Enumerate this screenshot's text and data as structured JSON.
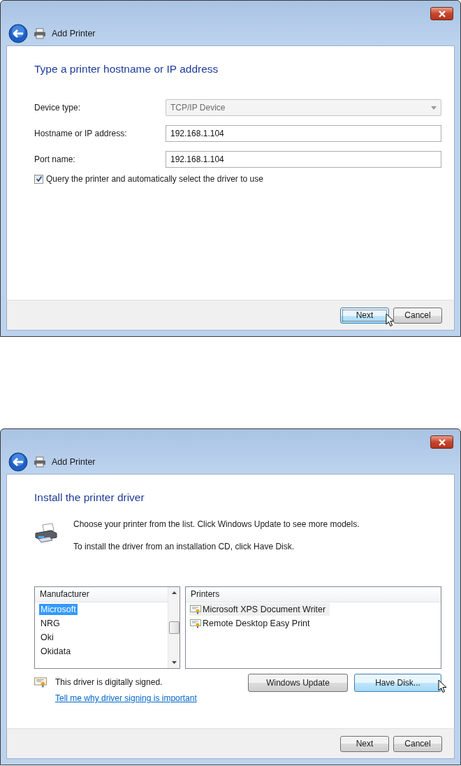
{
  "dialogs": [
    {
      "kind": "address",
      "title": "Add Printer",
      "heading": "Type a printer hostname or IP address",
      "fields": [
        {
          "kind": "dropdown",
          "label": "Device type:",
          "value": "TCP/IP Device",
          "disabled": true
        },
        {
          "kind": "text",
          "label": "Hostname or IP address:",
          "value": "192.168.1.104",
          "disabled": false
        },
        {
          "kind": "text",
          "label": "Port name:",
          "value": "192.168.1.104",
          "disabled": false
        }
      ],
      "checkbox": {
        "label": "Query the printer and automatically select the driver to use",
        "checked": true
      },
      "buttons": [
        {
          "label": "Next",
          "default": true,
          "hovered": true
        },
        {
          "label": "Cancel",
          "default": false,
          "hovered": false
        }
      ]
    },
    {
      "kind": "driver",
      "title": "Add Printer",
      "heading": "Install the printer driver",
      "intro": [
        "Choose your printer from the list. Click Windows Update to see more models.",
        "To install the driver from an installation CD, click Have Disk."
      ],
      "manufacturers": {
        "header": "Manufacturer",
        "items": [
          {
            "label": "Microsoft",
            "selected": true
          },
          {
            "label": "NRG",
            "selected": false
          },
          {
            "label": "Oki",
            "selected": false
          },
          {
            "label": "Okidata",
            "selected": false
          }
        ]
      },
      "printers": {
        "header": "Printers",
        "items": [
          {
            "label": "Microsoft XPS Document Writer",
            "selected": true
          },
          {
            "label": "Remote Desktop Easy Print",
            "selected": false
          }
        ]
      },
      "signed": "This driver is digitally signed.",
      "link": "Tell me why driver signing is important",
      "actions": [
        {
          "label": "Windows Update",
          "hovered": false
        },
        {
          "label": "Have Disk...",
          "hovered": true
        }
      ],
      "buttons": [
        {
          "label": "Next",
          "default": false,
          "hovered": false
        },
        {
          "label": "Cancel",
          "default": false,
          "hovered": false
        }
      ]
    }
  ]
}
